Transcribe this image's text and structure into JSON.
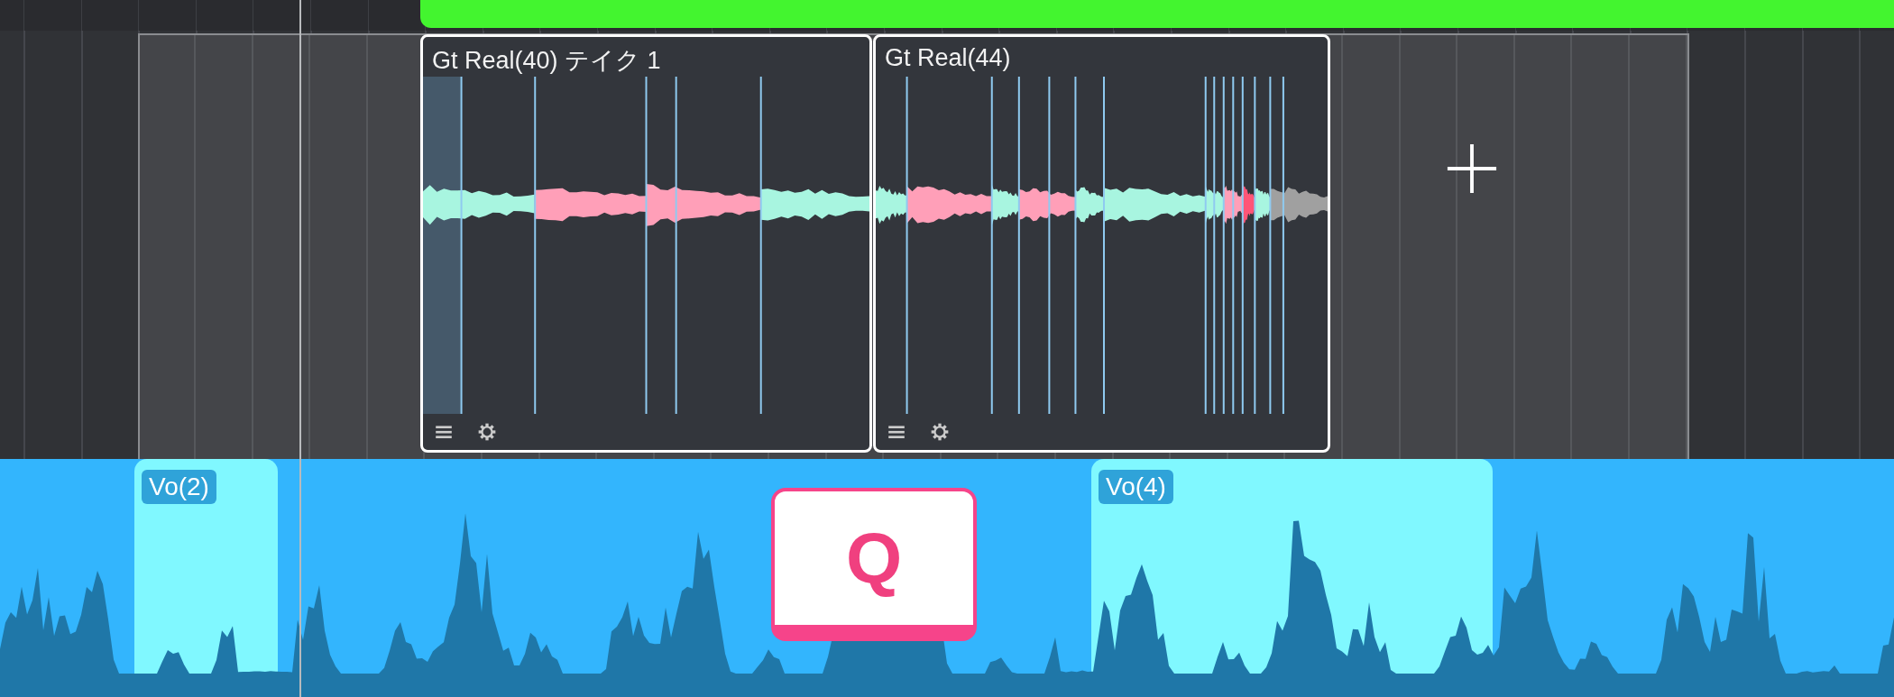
{
  "upper_track": {
    "clips": [
      {
        "title": "Gt Real(40) テイク 1",
        "selected": true
      },
      {
        "title": "Gt Real(44)",
        "selected": true
      }
    ]
  },
  "lower_track": {
    "regions": [
      {
        "label": "Vo(2)"
      },
      {
        "label": "Vo(4)"
      }
    ]
  },
  "key_overlay": {
    "label": "Q"
  }
}
